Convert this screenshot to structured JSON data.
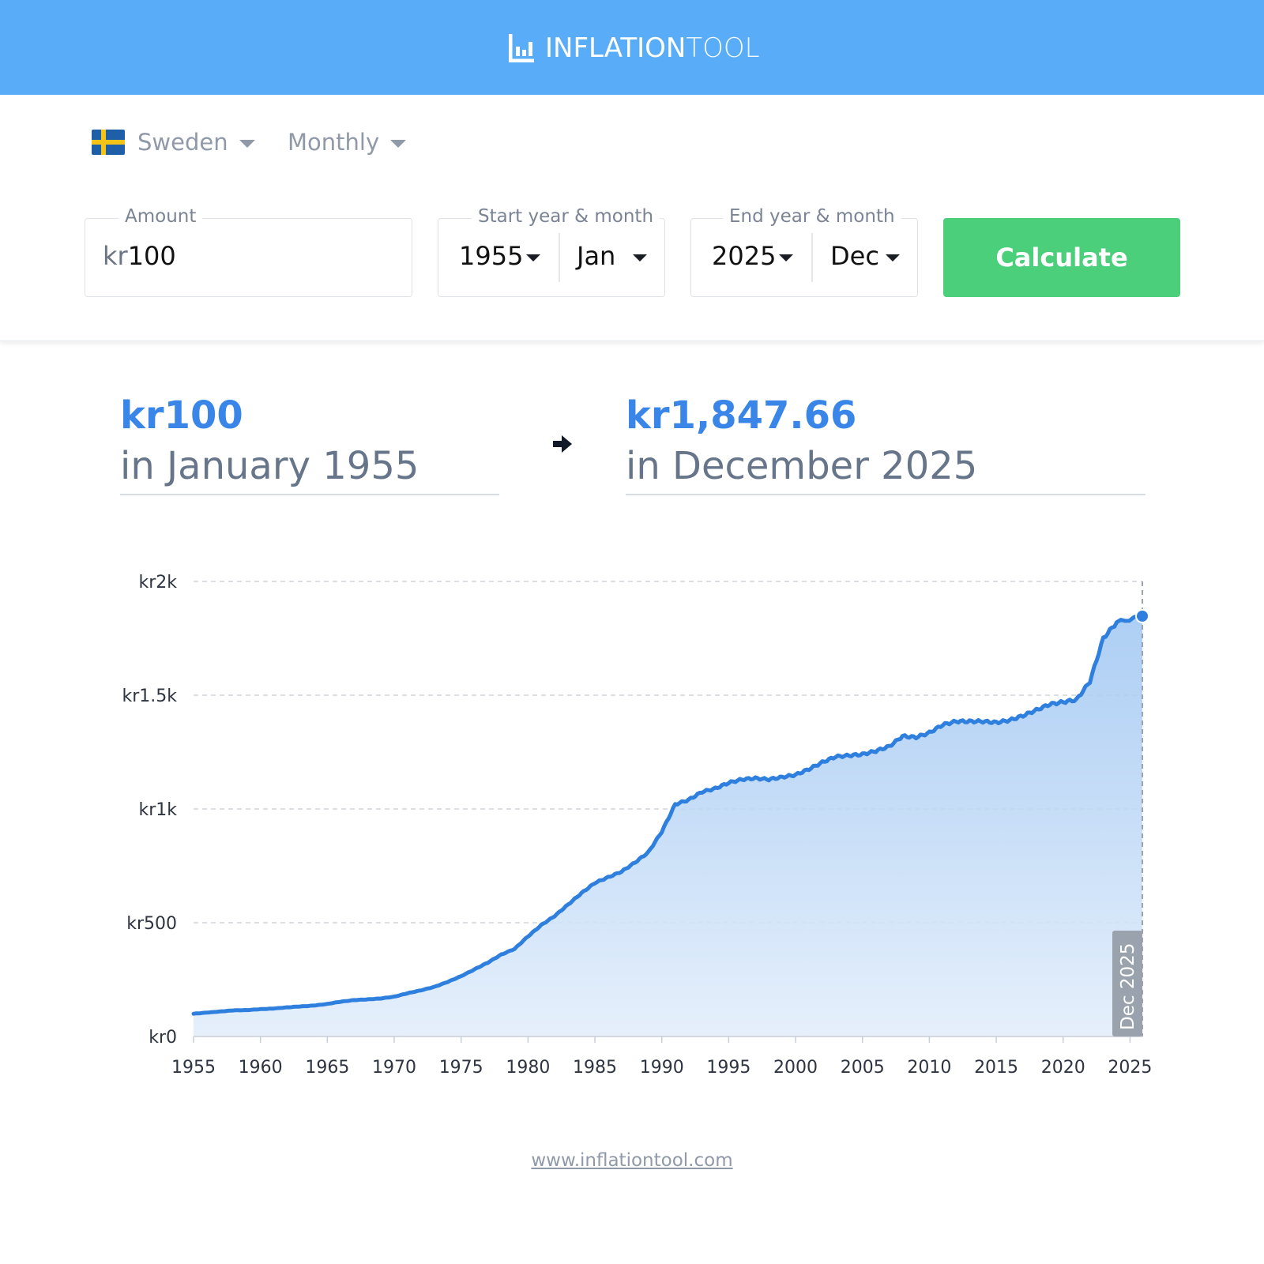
{
  "header": {
    "logo_primary": "INFLATION",
    "logo_secondary": "TOOL"
  },
  "controls": {
    "country": "Sweden",
    "frequency": "Monthly",
    "amount": {
      "legend": "Amount",
      "currency": "kr",
      "value": "100"
    },
    "start": {
      "legend": "Start year & month",
      "year": "1955",
      "month": "Jan"
    },
    "end": {
      "legend": "End year & month",
      "year": "2025",
      "month": "Dec"
    },
    "calculate_label": "Calculate"
  },
  "colors": {
    "header": "#59acf7",
    "accent": "#3a86e8",
    "button": "#4ccf7b",
    "line": "#2f80de"
  },
  "result": {
    "from_amount": "kr100",
    "from_date": "in January 1955",
    "to_amount": "kr1,847.66",
    "to_date": "in December 2025"
  },
  "chart_data": {
    "type": "area",
    "x_ticks": [
      "1955",
      "1960",
      "1965",
      "1970",
      "1975",
      "1980",
      "1985",
      "1990",
      "1995",
      "2000",
      "2005",
      "2010",
      "2015",
      "2020",
      "2025"
    ],
    "y_ticks": [
      {
        "value": 0,
        "label": "kr0"
      },
      {
        "value": 500,
        "label": "kr500"
      },
      {
        "value": 1000,
        "label": "kr1k"
      },
      {
        "value": 1500,
        "label": "kr1.5k"
      },
      {
        "value": 2000,
        "label": "kr2k"
      }
    ],
    "xlim": [
      1955,
      2025.92
    ],
    "ylim": [
      0,
      2000
    ],
    "grid": true,
    "marker_label": "Dec 2025",
    "points": [
      [
        1955,
        100
      ],
      [
        1956,
        105
      ],
      [
        1957,
        110
      ],
      [
        1958,
        115
      ],
      [
        1959,
        116
      ],
      [
        1960,
        120
      ],
      [
        1961,
        123
      ],
      [
        1962,
        128
      ],
      [
        1963,
        132
      ],
      [
        1964,
        136
      ],
      [
        1965,
        143
      ],
      [
        1966,
        153
      ],
      [
        1967,
        160
      ],
      [
        1968,
        163
      ],
      [
        1969,
        167
      ],
      [
        1970,
        175
      ],
      [
        1971,
        190
      ],
      [
        1972,
        203
      ],
      [
        1973,
        218
      ],
      [
        1974,
        240
      ],
      [
        1975,
        265
      ],
      [
        1976,
        295
      ],
      [
        1977,
        325
      ],
      [
        1978,
        360
      ],
      [
        1979,
        385
      ],
      [
        1980,
        440
      ],
      [
        1981,
        490
      ],
      [
        1982,
        530
      ],
      [
        1983,
        580
      ],
      [
        1984,
        630
      ],
      [
        1985,
        675
      ],
      [
        1986,
        700
      ],
      [
        1987,
        725
      ],
      [
        1988,
        765
      ],
      [
        1989,
        810
      ],
      [
        1990,
        900
      ],
      [
        1991,
        1020
      ],
      [
        1992,
        1040
      ],
      [
        1993,
        1075
      ],
      [
        1994,
        1090
      ],
      [
        1995,
        1115
      ],
      [
        1996,
        1130
      ],
      [
        1997,
        1135
      ],
      [
        1998,
        1130
      ],
      [
        1999,
        1140
      ],
      [
        2000,
        1150
      ],
      [
        2001,
        1175
      ],
      [
        2002,
        1205
      ],
      [
        2003,
        1230
      ],
      [
        2004,
        1235
      ],
      [
        2005,
        1240
      ],
      [
        2006,
        1255
      ],
      [
        2007,
        1275
      ],
      [
        2008,
        1320
      ],
      [
        2009,
        1315
      ],
      [
        2010,
        1335
      ],
      [
        2011,
        1370
      ],
      [
        2012,
        1385
      ],
      [
        2013,
        1385
      ],
      [
        2014,
        1385
      ],
      [
        2015,
        1380
      ],
      [
        2016,
        1390
      ],
      [
        2017,
        1410
      ],
      [
        2018,
        1435
      ],
      [
        2019,
        1460
      ],
      [
        2020,
        1470
      ],
      [
        2021,
        1480
      ],
      [
        2022,
        1560
      ],
      [
        2023,
        1750
      ],
      [
        2024,
        1820
      ],
      [
        2025.92,
        1847.66
      ]
    ]
  },
  "footer": {
    "link": "www.inflationtool.com"
  }
}
